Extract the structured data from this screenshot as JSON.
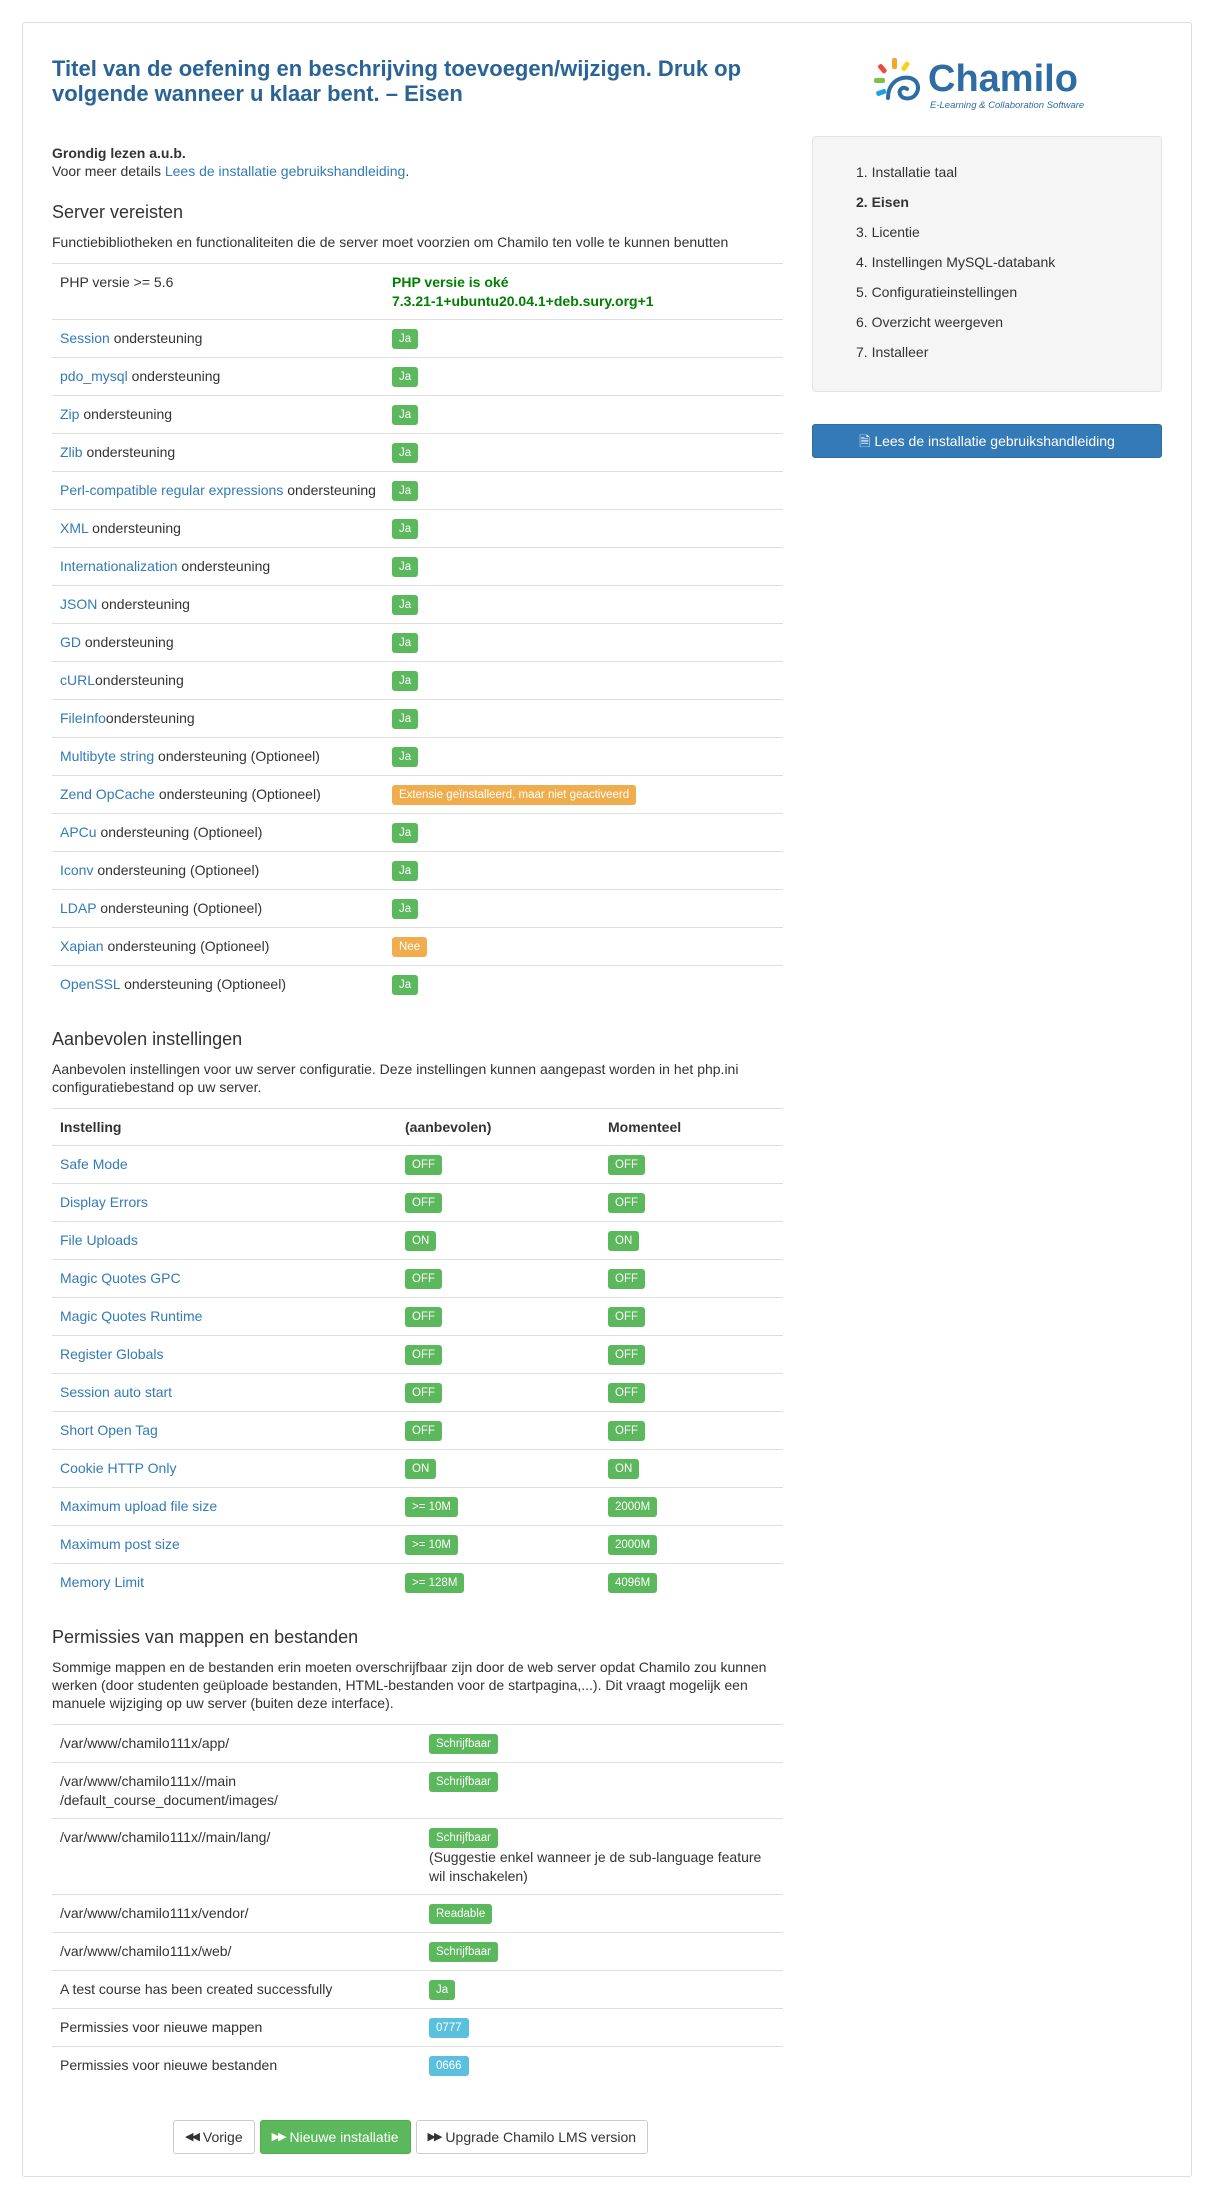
{
  "title": "Titel van de oefening en beschrijving toevoegen/wijzigen. Druk op volgende wanneer u klaar bent. – Eisen",
  "intro": {
    "read_carefully": "Grondig lezen a.u.b.",
    "details_prefix": "Voor meer details ",
    "details_link": "Lees de installatie gebruikshandleiding",
    "details_suffix": "."
  },
  "logo": {
    "name": "Chamilo",
    "tagline": "E-Learning & Collaboration Software"
  },
  "steps": [
    "1. Installatie taal",
    "2. Eisen",
    "3. Licentie",
    "4. Instellingen MySQL-databank",
    "5. Configuratieinstellingen",
    "6. Overzicht weergeven",
    "7. Installeer"
  ],
  "guide_button": "Lees de installatie gebruikshandleiding",
  "server": {
    "heading": "Server vereisten",
    "description": "Functiebibliotheken en functionaliteiten die de server moet voorzien om Chamilo ten volle te kunnen benutten",
    "php": {
      "label": "PHP versie >= 5.6",
      "status_line1": "PHP versie is oké",
      "status_line2": "7.3.21-1+ubuntu20.04.1+deb.sury.org+1"
    },
    "rows": [
      {
        "link": "Session",
        "text": " ondersteuning",
        "status": "Ja",
        "kind": "ok"
      },
      {
        "link": "pdo_mysql",
        "text": " ondersteuning",
        "status": "Ja",
        "kind": "ok"
      },
      {
        "link": "Zip",
        "text": " ondersteuning",
        "status": "Ja",
        "kind": "ok"
      },
      {
        "link": "Zlib",
        "text": " ondersteuning",
        "status": "Ja",
        "kind": "ok"
      },
      {
        "link": "Perl-compatible regular expressions",
        "text": " ondersteuning",
        "status": "Ja",
        "kind": "ok"
      },
      {
        "link": "XML",
        "text": " ondersteuning",
        "status": "Ja",
        "kind": "ok"
      },
      {
        "link": "Internationalization",
        "text": " ondersteuning",
        "status": "Ja",
        "kind": "ok"
      },
      {
        "link": "JSON",
        "text": " ondersteuning",
        "status": "Ja",
        "kind": "ok"
      },
      {
        "link": "GD",
        "text": " ondersteuning",
        "status": "Ja",
        "kind": "ok"
      },
      {
        "link": "cURL",
        "text": "ondersteuning",
        "status": "Ja",
        "kind": "ok"
      },
      {
        "link": "FileInfo",
        "text": "ondersteuning",
        "status": "Ja",
        "kind": "ok"
      },
      {
        "link": "Multibyte string",
        "text": " ondersteuning (Optioneel)",
        "status": "Ja",
        "kind": "ok"
      },
      {
        "link": "Zend OpCache",
        "text": " ondersteuning (Optioneel)",
        "status": "Extensie geïnstalleerd, maar niet geactiveerd",
        "kind": "warn"
      },
      {
        "link": "APCu",
        "text": " ondersteuning (Optioneel)",
        "status": "Ja",
        "kind": "ok"
      },
      {
        "link": "Iconv",
        "text": " ondersteuning (Optioneel)",
        "status": "Ja",
        "kind": "ok"
      },
      {
        "link": "LDAP",
        "text": " ondersteuning (Optioneel)",
        "status": "Ja",
        "kind": "ok"
      },
      {
        "link": "Xapian",
        "text": " ondersteuning (Optioneel)",
        "status": "Nee",
        "kind": "warn"
      },
      {
        "link": "OpenSSL",
        "text": " ondersteuning (Optioneel)",
        "status": "Ja",
        "kind": "ok"
      }
    ]
  },
  "recommended": {
    "heading": "Aanbevolen instellingen",
    "description": "Aanbevolen instellingen voor uw server configuratie. Deze instellingen kunnen aangepast worden in het php.ini configuratiebestand op uw server.",
    "headers": [
      "Instelling",
      "(aanbevolen)",
      "Momenteel"
    ],
    "rows": [
      {
        "setting": "Safe Mode",
        "recommended": "OFF",
        "current": "OFF"
      },
      {
        "setting": "Display Errors",
        "recommended": "OFF",
        "current": "OFF"
      },
      {
        "setting": "File Uploads",
        "recommended": "ON",
        "current": "ON"
      },
      {
        "setting": "Magic Quotes GPC",
        "recommended": "OFF",
        "current": "OFF"
      },
      {
        "setting": "Magic Quotes Runtime",
        "recommended": "OFF",
        "current": "OFF"
      },
      {
        "setting": "Register Globals",
        "recommended": "OFF",
        "current": "OFF"
      },
      {
        "setting": "Session auto start",
        "recommended": "OFF",
        "current": "OFF"
      },
      {
        "setting": "Short Open Tag",
        "recommended": "OFF",
        "current": "OFF"
      },
      {
        "setting": "Cookie HTTP Only",
        "recommended": "ON",
        "current": "ON"
      },
      {
        "setting": "Maximum upload file size",
        "recommended": ">= 10M",
        "current": "2000M"
      },
      {
        "setting": "Maximum post size",
        "recommended": ">= 10M",
        "current": "2000M"
      },
      {
        "setting": "Memory Limit",
        "recommended": ">= 128M",
        "current": "4096M"
      }
    ]
  },
  "permissions": {
    "heading": "Permissies van mappen en bestanden",
    "description": "Sommige mappen en de bestanden erin moeten overschrijfbaar zijn door de web server opdat Chamilo zou kunnen werken (door studenten geüploade bestanden, HTML-bestanden voor de startpagina,...). Dit vraagt mogelijk een manuele wijziging op uw server (buiten deze interface).",
    "rows": [
      {
        "path": "/var/www/chamilo111x/app/",
        "status": "Schrijfbaar",
        "kind": "ok",
        "note": ""
      },
      {
        "path": "/var/www/chamilo111x//main\n/default_course_document/images/",
        "status": "Schrijfbaar",
        "kind": "ok",
        "note": ""
      },
      {
        "path": "/var/www/chamilo111x//main/lang/",
        "status": "Schrijfbaar",
        "kind": "ok",
        "note": "(Suggestie enkel wanneer je de sub-language feature wil inschakelen)"
      },
      {
        "path": "/var/www/chamilo111x/vendor/",
        "status": "Readable",
        "kind": "ok",
        "note": ""
      },
      {
        "path": "/var/www/chamilo111x/web/",
        "status": "Schrijfbaar",
        "kind": "ok",
        "note": ""
      },
      {
        "path": "A test course has been created successfully",
        "status": "Ja",
        "kind": "ok",
        "note": ""
      },
      {
        "path": "Permissies voor nieuwe mappen",
        "status": "0777",
        "kind": "info",
        "note": ""
      },
      {
        "path": "Permissies voor nieuwe bestanden",
        "status": "0666",
        "kind": "info",
        "note": ""
      }
    ]
  },
  "buttons": {
    "previous": "Vorige",
    "new_install": "Nieuwe installatie",
    "upgrade": "Upgrade Chamilo LMS version"
  }
}
